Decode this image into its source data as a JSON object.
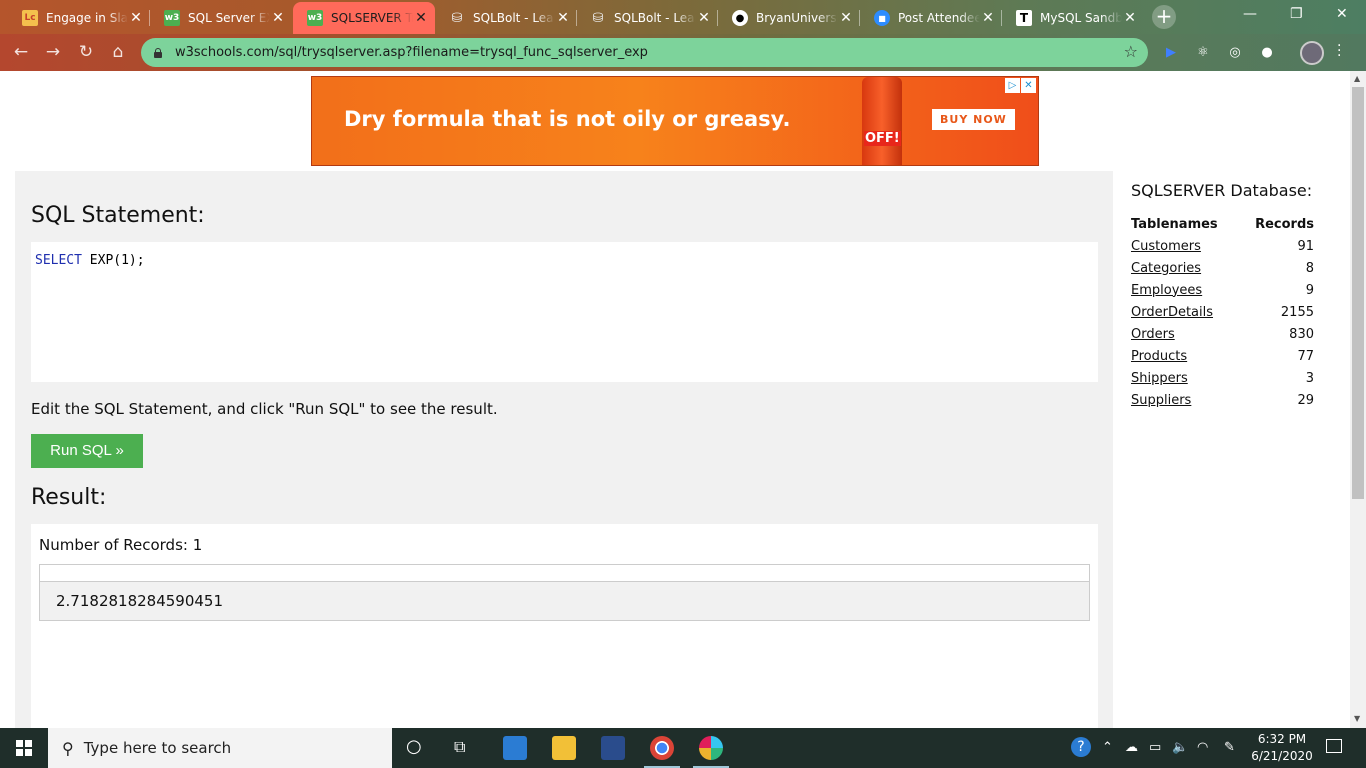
{
  "browser": {
    "tabs": [
      {
        "title": "Engage in Slack",
        "favicon": "slack-icon",
        "color": "#e8a33d",
        "active": false
      },
      {
        "title": "SQL Server EXP",
        "favicon": "w3schools-icon",
        "color": "#4caf50",
        "active": false
      },
      {
        "title": "SQLSERVER Tryit",
        "favicon": "w3schools-icon",
        "color": "#4caf50",
        "active": true
      },
      {
        "title": "SQLBolt - Learn",
        "favicon": "database-icon",
        "color": "#dddddd",
        "active": false
      },
      {
        "title": "SQLBolt - Learn",
        "favicon": "database-icon",
        "color": "#dddddd",
        "active": false
      },
      {
        "title": "BryanUniversity",
        "favicon": "github-icon",
        "color": "#ffffff",
        "active": false
      },
      {
        "title": "Post Attendee",
        "favicon": "zoom-icon",
        "color": "#2d8cff",
        "active": false
      },
      {
        "title": "MySQL Sandbox",
        "favicon": "t-icon",
        "color": "#ffffff",
        "active": false
      }
    ],
    "new_tab_label": "+",
    "url": "w3schools.com/sql/trysqlserver.asp?filename=trysql_func_sqlserver_exp"
  },
  "ad": {
    "headline": "Dry formula that is not oily or greasy.",
    "brand": "OFF!",
    "cta": "BUY NOW"
  },
  "editor": {
    "heading": "SQL Statement:",
    "code_keyword": "SELECT",
    "code_rest": " EXP(1);",
    "instruction": "Edit the SQL Statement, and click \"Run SQL\" to see the result.",
    "run_label": "Run SQL »"
  },
  "result": {
    "heading": "Result:",
    "record_count": "Number of Records: 1",
    "value": "2.7182818284590451"
  },
  "sidebar": {
    "title": "SQLSERVER Database:",
    "col_names": "Tablenames",
    "col_records": "Records",
    "tables": [
      {
        "name": "Customers",
        "records": "91"
      },
      {
        "name": "Categories",
        "records": "8"
      },
      {
        "name": "Employees",
        "records": "9"
      },
      {
        "name": "OrderDetails",
        "records": "2155"
      },
      {
        "name": "Orders",
        "records": "830"
      },
      {
        "name": "Products",
        "records": "77"
      },
      {
        "name": "Shippers",
        "records": "3"
      },
      {
        "name": "Suppliers",
        "records": "29"
      }
    ]
  },
  "taskbar": {
    "search_placeholder": "Type here to search",
    "time": "6:32 PM",
    "date": "6/21/2020"
  },
  "colors": {
    "run_button": "#4caf50",
    "panel_bg": "#f1f1f1",
    "omnibox": "#7dd39b",
    "active_tab": "#ff6a5a"
  }
}
